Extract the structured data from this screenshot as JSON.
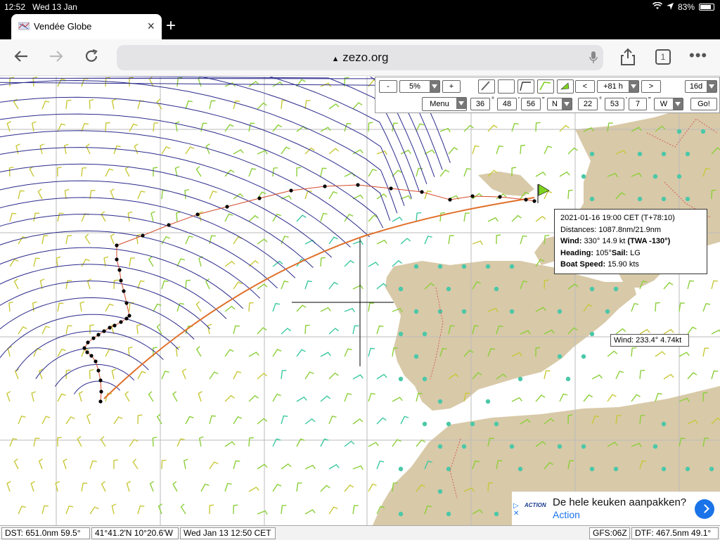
{
  "status": {
    "time": "12:52",
    "date": "Wed 13 Jan",
    "battery": "83%",
    "battery_level": 0.83
  },
  "tab": {
    "title": "Vendée Globe",
    "close": "×",
    "new_tab": "+"
  },
  "toolbar": {
    "url": "zezo.org",
    "tab_count": "1"
  },
  "map_controls": {
    "zoom_minus": "-",
    "zoom_value": "5%",
    "zoom_plus": "+",
    "time_prev": "<",
    "time_offset": "+81 h",
    "time_next": ">",
    "range": "16d",
    "menu": "Menu",
    "lat_deg": "36",
    "lat_min": "48",
    "lat_sec": "56",
    "lat_hemi": "N",
    "lon_deg": "22",
    "lon_min": "53",
    "lon_sec": "7",
    "lon_hemi": "W",
    "go": "Go!",
    "deg_mark": "°",
    "min_mark": "'",
    "sec_mark": "\""
  },
  "infobox": {
    "line1": "2021-01-16 19:00 CET (T+78:10)",
    "line2": "Distances: 1087.8nm/21.9nm",
    "wind_label": "Wind:",
    "wind_value": " 330° 14.9 kt ",
    "twa": "(TWA -130°)",
    "heading_label": "Heading:",
    "heading_value": " 105°",
    "sail_label": "Sail:",
    "sail_value": " LG",
    "speed_label": "Boat Speed:",
    "speed_value": " 15.90 kts"
  },
  "wind_cursor": {
    "label": "Wind: 233.4° 4.74kt"
  },
  "ad": {
    "headline": "De hele keuken aanpakken?",
    "cta": "Action",
    "brand": "ACTION"
  },
  "footer": {
    "dst": "DST: 651.0nm  59.5°",
    "pos": "41°41.2'N 10°20.6'W",
    "date": "Wed Jan 13 12:50 CET",
    "gfs": "GFS:06Z",
    "dtf": "DTF: 467.5nm  49.1°"
  },
  "colors": {
    "land": "#d8c9a8",
    "isochrone": "#2a2a8c",
    "route": "#e0702a",
    "path": "#d44a2a",
    "barb_green": "#8ccf3a",
    "barb_yellow": "#c8c83a",
    "barb_teal": "#3ac8a0"
  }
}
